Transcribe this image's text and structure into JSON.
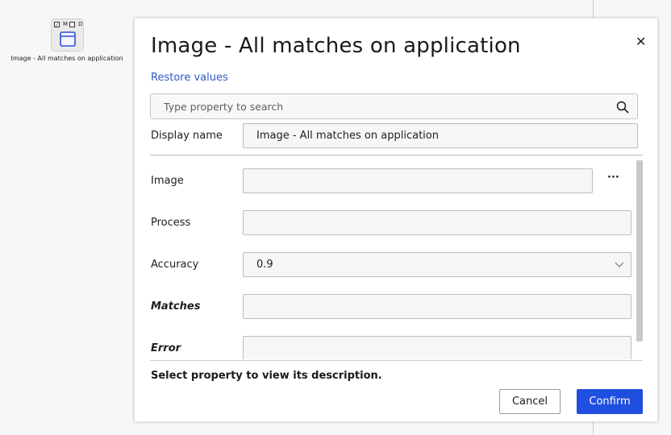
{
  "canvas": {
    "node": {
      "m_label": "M",
      "d_label": "D",
      "caption": "Image - All matches on application"
    }
  },
  "dialog": {
    "title": "Image - All matches on application",
    "restore_label": "Restore values",
    "search": {
      "placeholder": "Type property to search"
    },
    "display_name": {
      "label": "Display name",
      "value": "Image - All matches on application"
    },
    "properties": [
      {
        "label": "Image",
        "value": "",
        "more": "···"
      },
      {
        "label": "Process",
        "value": ""
      },
      {
        "label": "Accuracy",
        "value": "0.9"
      },
      {
        "label": "Matches",
        "value": ""
      },
      {
        "label": "Error",
        "value": ""
      }
    ],
    "description": "Select property to view its description.",
    "cancel_label": "Cancel",
    "confirm_label": "Confirm",
    "accent_color": "#1f4fe0"
  }
}
